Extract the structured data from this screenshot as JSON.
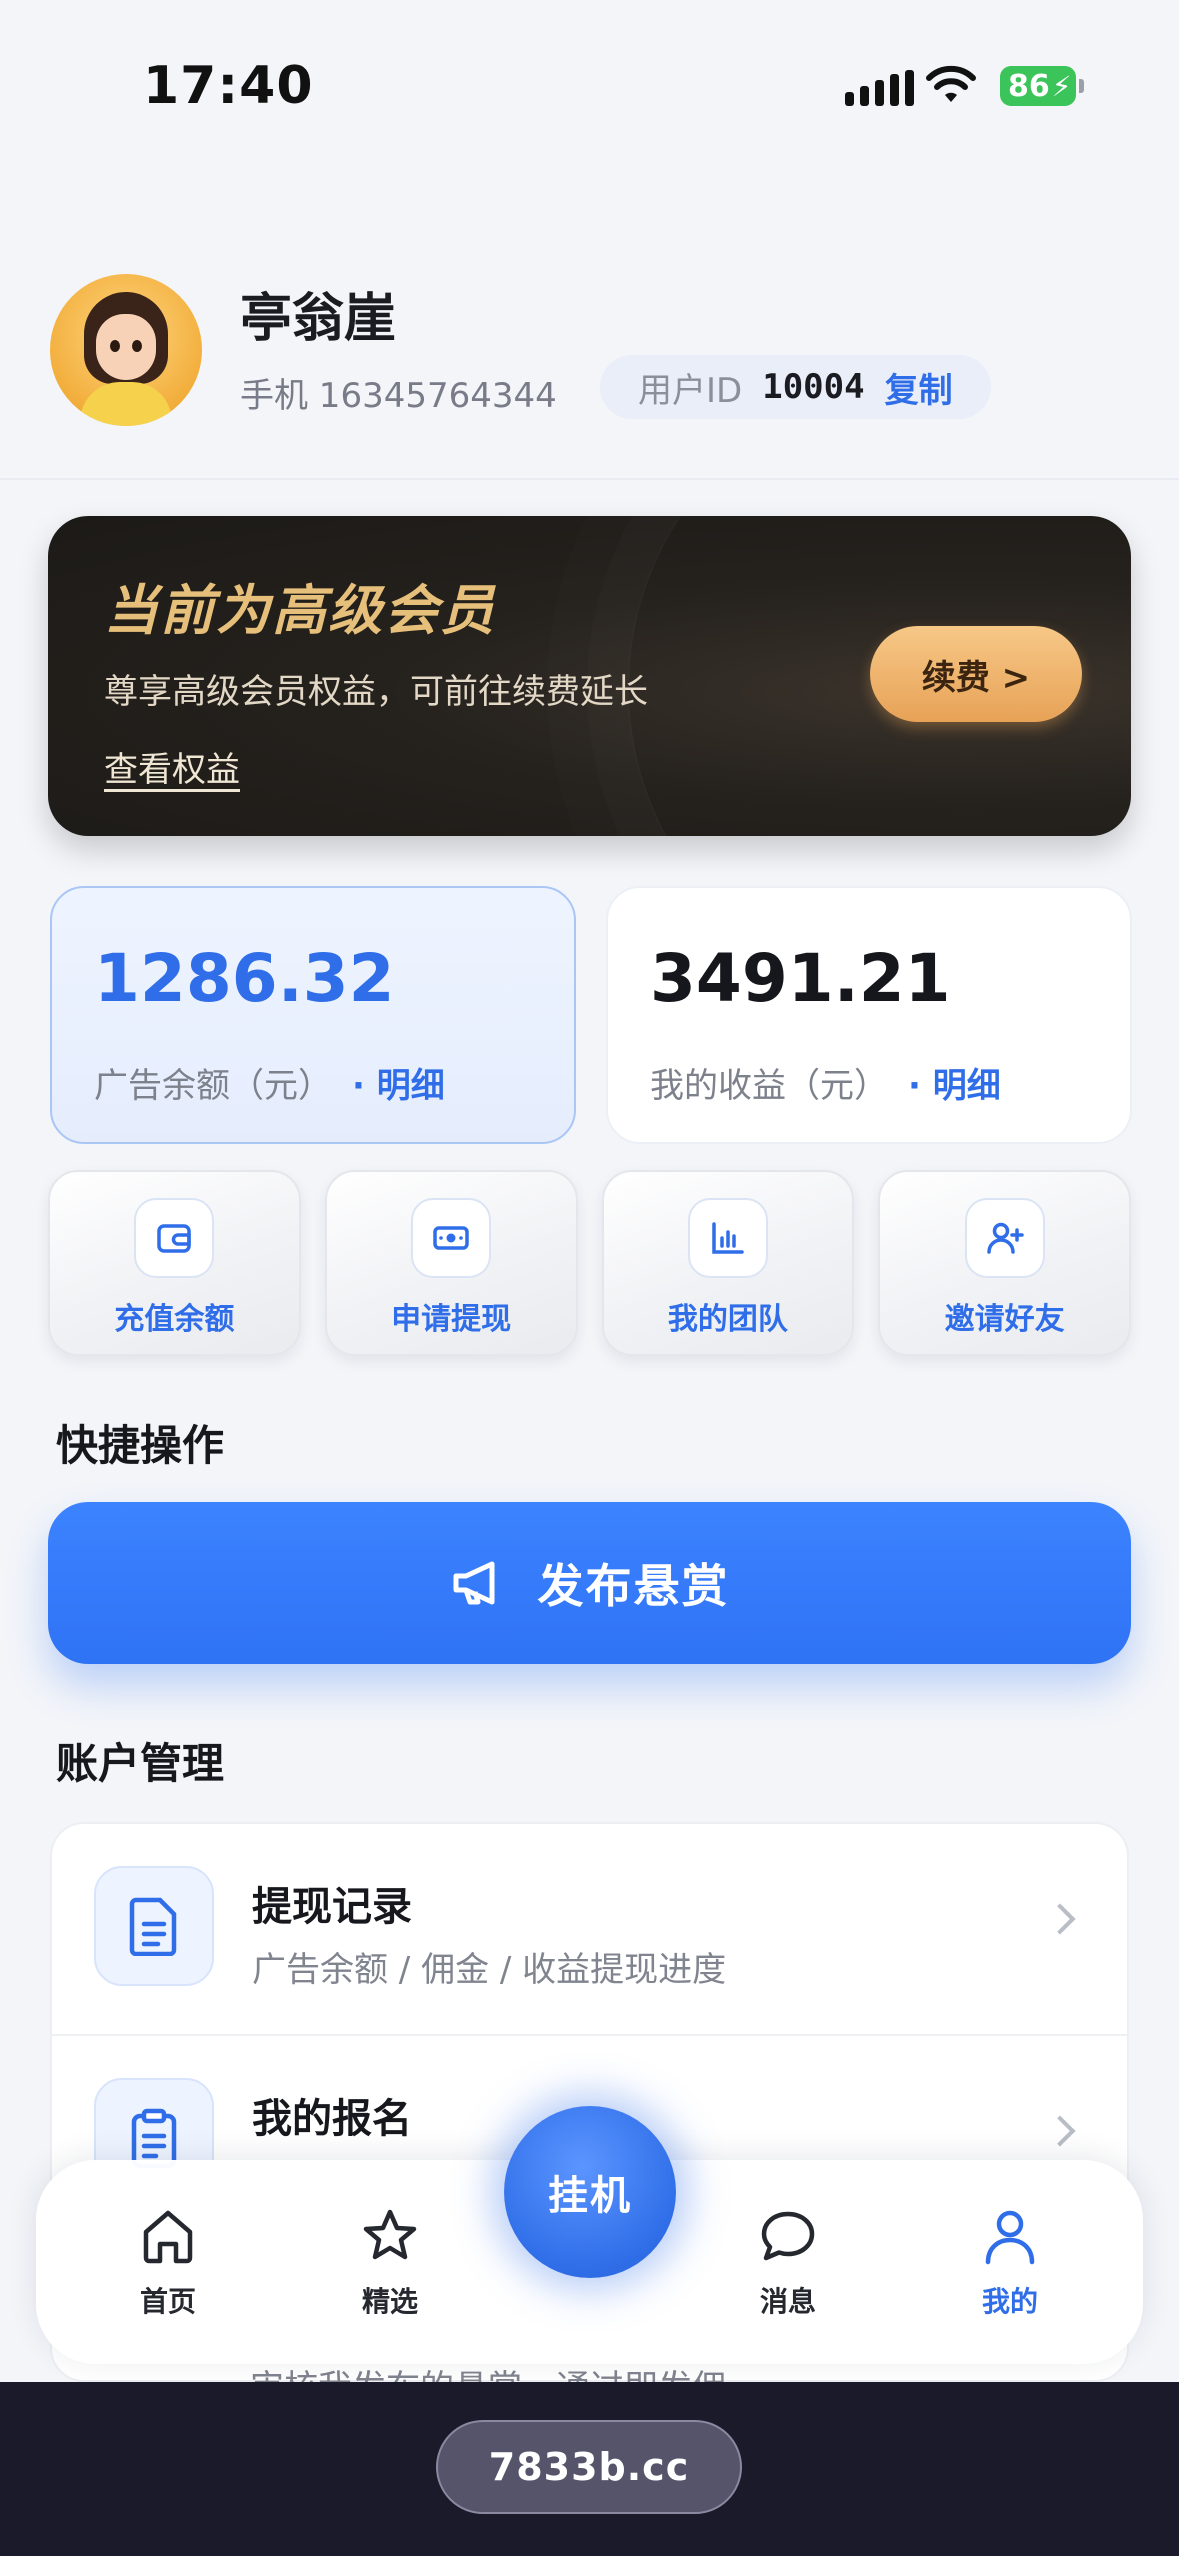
{
  "status_bar": {
    "time": "17:40",
    "battery": "86"
  },
  "profile": {
    "name": "亭翁崖",
    "phone": "手机 16345764344",
    "uid_label": "用户ID",
    "uid_value": "10004",
    "copy_label": "复制"
  },
  "member": {
    "title": "当前为高级会员",
    "description": "尊享高级会员权益，可前往续费延长",
    "benefits_link": "查看权益",
    "renew_button": "续费 >"
  },
  "balances": {
    "ad": {
      "value": "1286.32",
      "label": "广告余额（元）",
      "detail": "· 明细"
    },
    "income": {
      "value": "3491.21",
      "label": "我的收益（元）",
      "detail": "· 明细"
    }
  },
  "actions": [
    {
      "label": "充值余额",
      "icon": "wallet-icon"
    },
    {
      "label": "申请提现",
      "icon": "cash-icon"
    },
    {
      "label": "我的团队",
      "icon": "bar-chart-icon"
    },
    {
      "label": "邀请好友",
      "icon": "add-user-icon"
    }
  ],
  "quick": {
    "title": "快捷操作",
    "publish_button": "发布悬赏"
  },
  "account": {
    "title": "账户管理",
    "items": [
      {
        "title": "提现记录",
        "subtitle": "广告余额 / 佣金 / 收益提现进度",
        "icon": "document-icon"
      },
      {
        "title": "我的报名",
        "subtitle": "",
        "icon": "clipboard-icon"
      }
    ],
    "partial_text": "审核我发布的悬赏，通过即发佣"
  },
  "tabbar": {
    "home": "首页",
    "picks": "精选",
    "center": "挂机",
    "messages": "消息",
    "mine": "我的"
  },
  "footer": {
    "domain": "7833b.cc"
  },
  "colors": {
    "accent": "#2f6ee8",
    "gold": "#e6bf7a",
    "dark_card": "#1c1a17"
  }
}
